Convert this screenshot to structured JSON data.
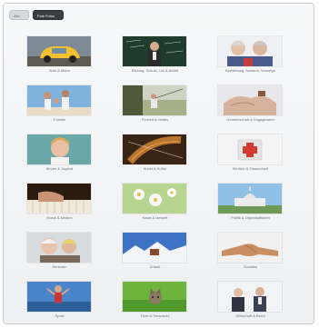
{
  "toolbar": {
    "button_1": "Alle",
    "button_2": "Foto Fotos"
  },
  "tiles": [
    {
      "label": "Auto & Motor",
      "icon": "car-icon"
    },
    {
      "label": "Bildung, Schule, Uni & Arbeit",
      "icon": "teacher-icon"
    },
    {
      "label": "Bewerbung, Ausland, Vorsorge",
      "icon": "seniors-icon"
    },
    {
      "label": "Familie",
      "icon": "family-icon"
    },
    {
      "label": "Freizeit & Hobby",
      "icon": "fishing-icon"
    },
    {
      "label": "Gemeinschaft & Engagement",
      "icon": "hands-icon"
    },
    {
      "label": "Kinder & Jugend",
      "icon": "child-icon"
    },
    {
      "label": "Kunst & Kultur",
      "icon": "violin-icon"
    },
    {
      "label": "Medizin & Gesundheit",
      "icon": "first-aid-icon"
    },
    {
      "label": "Musik & Medien",
      "icon": "piano-icon"
    },
    {
      "label": "Natur & Umwelt",
      "icon": "blossom-icon"
    },
    {
      "label": "Politik & Organisationen",
      "icon": "capitol-icon"
    },
    {
      "label": "Senioren",
      "icon": "elderly-icon"
    },
    {
      "label": "Urlaub",
      "icon": "winter-icon"
    },
    {
      "label": "Soziales",
      "icon": "handshake-icon"
    },
    {
      "label": "Sport",
      "icon": "sport-icon"
    },
    {
      "label": "Tiere & Tierschutz",
      "icon": "cat-icon"
    },
    {
      "label": "Wirtschaft & Beruf",
      "icon": "business-icon"
    }
  ]
}
